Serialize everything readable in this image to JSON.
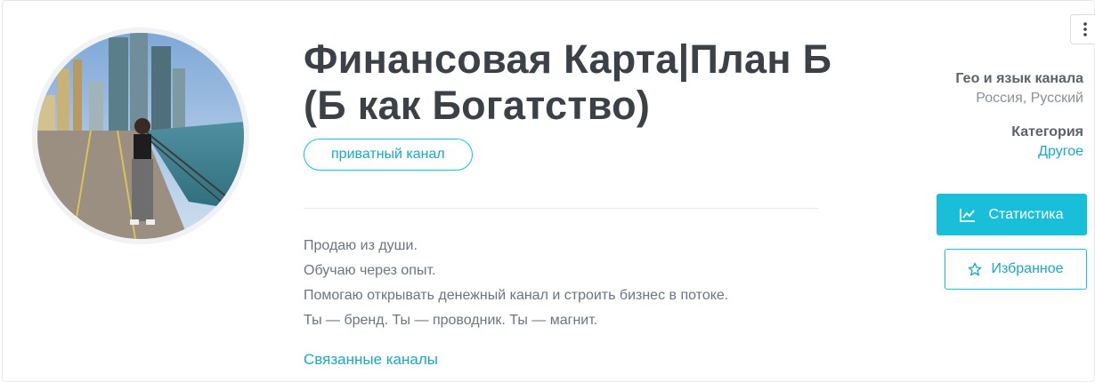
{
  "channel": {
    "title": "Финансовая Карта|План Б (Б как Богатство)",
    "badge_label": "приватный канал",
    "description": [
      "Продаю из души.",
      "Обучаю через опыт.",
      "Помогаю открывать денежный канал и строить бизнес в потоке.",
      "Ты — бренд. Ты — проводник. Ты — магнит."
    ],
    "related_link": "Связанные каналы",
    "avatar_icon": "channel-avatar-photo"
  },
  "sidebar": {
    "geo_label": "Гео и язык канала",
    "geo_value": "Россия, Русский",
    "category_label": "Категория",
    "category_value": "Другое",
    "stats_button": "Статистика",
    "favorite_button": "Избранное",
    "menu_icon": "more-vertical-icon",
    "stats_icon": "line-chart-icon",
    "favorite_icon": "star-icon"
  },
  "colors": {
    "accent": "#19bfd9",
    "accent_text": "#19a8c4",
    "title": "#3c4148",
    "muted": "#8a9099"
  }
}
